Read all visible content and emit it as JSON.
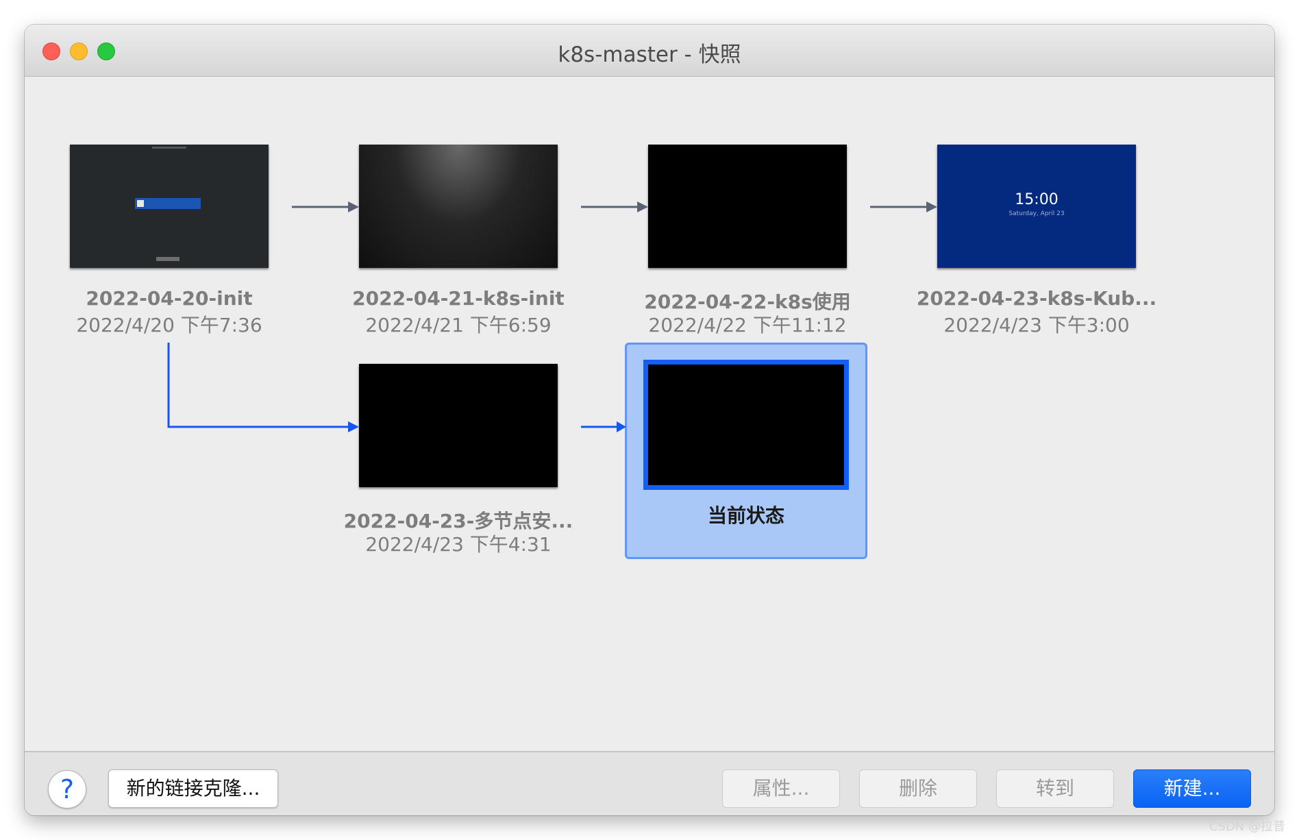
{
  "window": {
    "title": "k8s-master - 快照"
  },
  "snapshots": [
    {
      "name": "2022-04-20-init",
      "date": "2022/4/20 下午7:36",
      "thumb": "login-screen"
    },
    {
      "name": "2022-04-21-k8s-init",
      "date": "2022/4/21 下午6:59",
      "thumb": "moon-screen"
    },
    {
      "name": "2022-04-22-k8s使用",
      "date": "2022/4/22 下午11:12",
      "thumb": "black-screen"
    },
    {
      "name": "2022-04-23-k8s-Kub...",
      "date": "2022/4/23 下午3:00",
      "thumb": "lock-screen"
    },
    {
      "name": "2022-04-23-多节点安...",
      "date": "2022/4/23 下午4:31",
      "thumb": "black-screen"
    }
  ],
  "current": {
    "label": "当前状态"
  },
  "lockscreen": {
    "time": "15:00",
    "date": "Saturday, April 23"
  },
  "footer": {
    "help_label": "?",
    "linked_clone_label": "新的链接克隆...",
    "properties_label": "属性...",
    "delete_label": "删除",
    "goto_label": "转到",
    "new_label": "新建..."
  },
  "watermark": "CSDN @拉普",
  "colors": {
    "accent": "#1160f5",
    "selection_bg": "#a9c7f7",
    "arrow_gray": "#5a6275",
    "branch_blue": "#1556f2",
    "lockscreen_bg": "#042a7f"
  }
}
